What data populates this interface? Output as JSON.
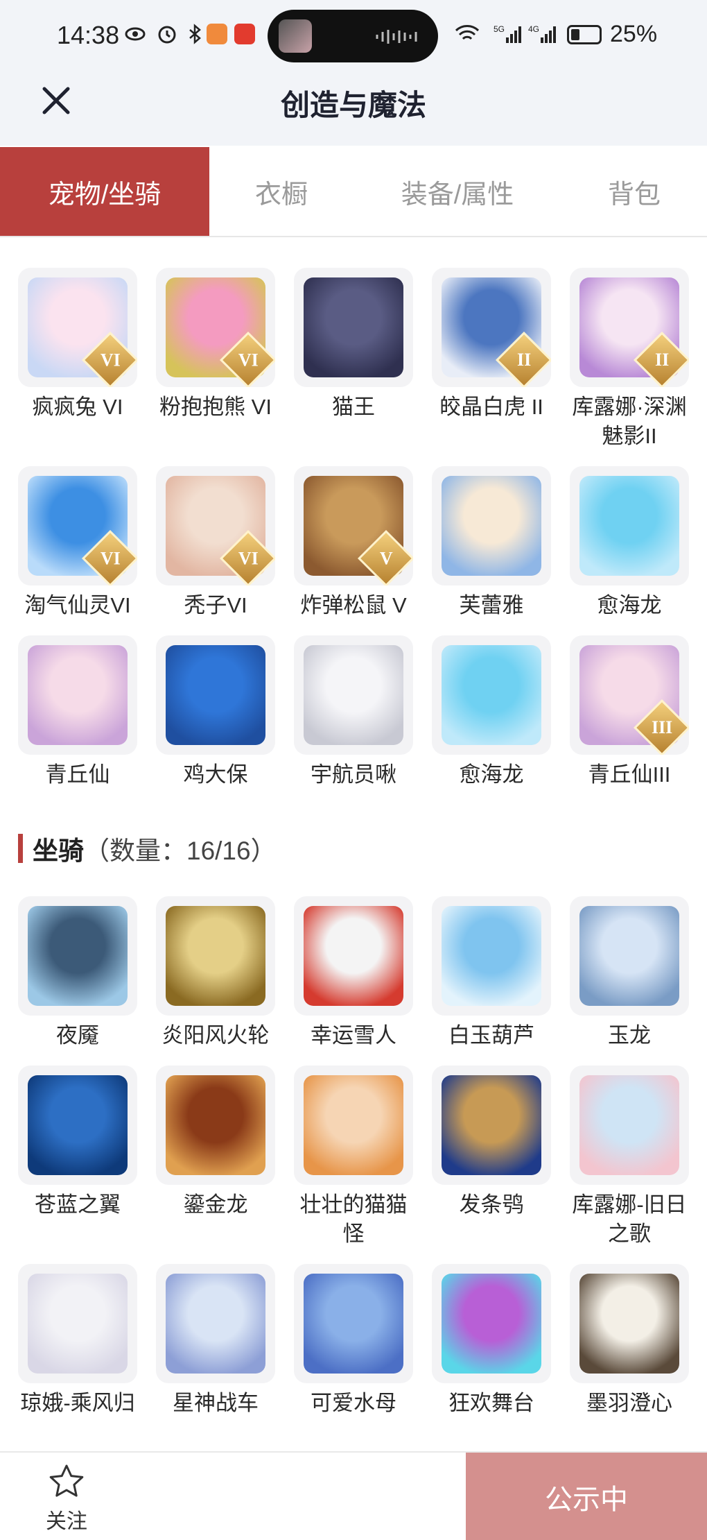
{
  "status_bar": {
    "time": "14:38",
    "battery": "25%"
  },
  "nav": {
    "title": "创造与魔法"
  },
  "tabs": [
    {
      "label": "宠物/坐骑",
      "active": true
    },
    {
      "label": "衣橱",
      "active": false
    },
    {
      "label": "装备/属性",
      "active": false
    },
    {
      "label": "背包",
      "active": false
    }
  ],
  "pets": [
    {
      "name": "疯疯兔 VI",
      "badge": "VI",
      "icon": "rabbit-icon"
    },
    {
      "name": "粉抱抱熊 VI",
      "badge": "VI",
      "icon": "bear-icon"
    },
    {
      "name": "猫王",
      "badge": "",
      "icon": "cat-icon"
    },
    {
      "name": "皎晶白虎 II",
      "badge": "II",
      "icon": "tiger-icon"
    },
    {
      "name": "库露娜·深渊魅影II",
      "badge": "II",
      "icon": "girl-icon"
    },
    {
      "name": "淘气仙灵VI",
      "badge": "VI",
      "icon": "blue-pup-icon"
    },
    {
      "name": "秃子VI",
      "badge": "VI",
      "icon": "bald-icon"
    },
    {
      "name": "炸弹松鼠 V",
      "badge": "V",
      "icon": "squirrel-icon"
    },
    {
      "name": "芙蕾雅",
      "badge": "",
      "icon": "valkyrie-icon"
    },
    {
      "name": "愈海龙",
      "badge": "",
      "icon": "dragon-icon"
    },
    {
      "name": "青丘仙",
      "badge": "",
      "icon": "fox-girl-icon"
    },
    {
      "name": "鸡大保",
      "badge": "",
      "icon": "bird-icon"
    },
    {
      "name": "宇航员啾",
      "badge": "",
      "icon": "astronaut-icon"
    },
    {
      "name": "愈海龙",
      "badge": "",
      "icon": "dragon-icon"
    },
    {
      "name": "青丘仙III",
      "badge": "III",
      "icon": "fox-girl-icon"
    }
  ],
  "mount_section": {
    "title": "坐骑",
    "count": "（数量：16/16）"
  },
  "mounts": [
    {
      "name": "夜魇",
      "icon": "nightmare-horse-icon"
    },
    {
      "name": "炎阳风火轮",
      "icon": "wheel-icon"
    },
    {
      "name": "幸运雪人",
      "icon": "snowman-icon"
    },
    {
      "name": "白玉葫芦",
      "icon": "gourd-icon"
    },
    {
      "name": "玉龙",
      "icon": "jade-dragon-icon"
    },
    {
      "name": "苍蓝之翼",
      "icon": "blue-wing-icon"
    },
    {
      "name": "鎏金龙",
      "icon": "gold-dragon-icon"
    },
    {
      "name": "壮壮的猫猫怪",
      "icon": "cat-monster-icon"
    },
    {
      "name": "发条鸮",
      "icon": "owl-icon"
    },
    {
      "name": "库露娜-旧日之歌",
      "icon": "girl-icon"
    },
    {
      "name": "琼娥-乘风归",
      "icon": "fairy-icon"
    },
    {
      "name": "星神战车",
      "icon": "chariot-icon"
    },
    {
      "name": "可爱水母",
      "icon": "jellyfish-icon"
    },
    {
      "name": "狂欢舞台",
      "icon": "stage-icon"
    },
    {
      "name": "墨羽澄心",
      "icon": "sword-icon"
    }
  ],
  "bottom": {
    "follow_label": "关注",
    "public_label": "公示中"
  }
}
